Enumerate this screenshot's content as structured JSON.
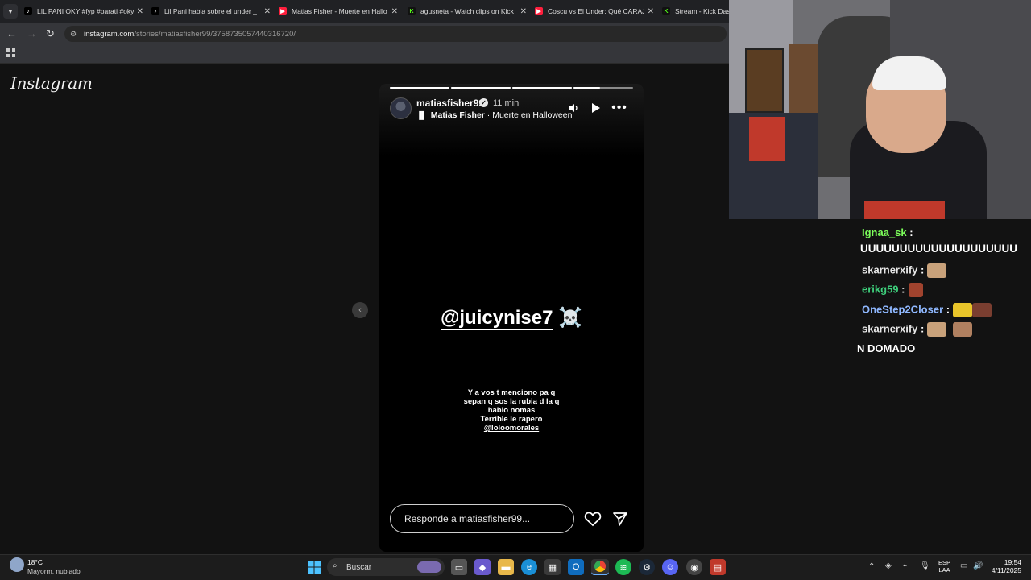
{
  "browser": {
    "tabs": [
      {
        "title": "LIL PANI OKY #fyp #parati #oky",
        "icon": "tiktok-icon"
      },
      {
        "title": "Lil Pani habla sobre el under _",
        "icon": "tiktok-icon"
      },
      {
        "title": "Matias Fisher - Muerte en Hallo",
        "icon": "youtube-icon"
      },
      {
        "title": "agusneta - Watch clips on Kick",
        "icon": "kick-icon"
      },
      {
        "title": "Coscu vs El Under: Qué CARAJO",
        "icon": "youtube-icon"
      },
      {
        "title": "Stream - Kick Dash",
        "icon": "kick-icon"
      }
    ],
    "url_host": "instagram.com",
    "url_path": "/stories/matiasfisher99/3758735057440316720/"
  },
  "instagram": {
    "logo": "Instagram",
    "story": {
      "username": "matiasfisher99",
      "time": "11 min",
      "music_artist": "Matias Fisher",
      "music_separator": " · ",
      "music_title": "Muerte en Halloween",
      "progress": [
        1,
        1,
        1,
        0.45
      ],
      "mention": "@juicynise7",
      "mention_emoji": "☠️",
      "caption_lines": [
        "Y a vos t menciono pa q",
        "sepan q sos la rubia d la q",
        "hablo nomas",
        "Terrible le rapero"
      ],
      "caption_mention": "@loloomorales",
      "reply_placeholder": "Responde a matiasfisher99..."
    }
  },
  "chat": [
    {
      "user": "Ignaa_sk",
      "sep": " :",
      "color": "#7cff5a",
      "message": "UUUUUUUUUUUUUUUUUUUU"
    },
    {
      "user": "skarnerxify",
      "sep": " :",
      "color": "#e8e8e8",
      "message": ""
    },
    {
      "user": "erikg59",
      "sep": " :",
      "color": "#3ed07c",
      "message": ""
    },
    {
      "user": "OneStep2Closer",
      "sep": " :",
      "color": "#8fb8ff",
      "message": ""
    },
    {
      "user": "skarnerxify",
      "sep": " :",
      "color": "#e8e8e8",
      "message": ""
    }
  ],
  "chat_fragment": "N DOMADO",
  "taskbar": {
    "weather_temp": "18°C",
    "weather_desc": "Mayorm. nublado",
    "search": "Buscar",
    "lang_top": "ESP",
    "lang_bottom": "LAA",
    "time": "19:54",
    "date": "4/11/2025"
  }
}
